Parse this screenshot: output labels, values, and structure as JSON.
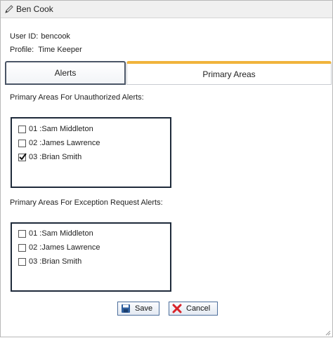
{
  "window": {
    "title": "Ben Cook"
  },
  "user": {
    "id_label": "User ID:",
    "id_value": "bencook",
    "profile_label": "Profile:",
    "profile_value": "Time Keeper"
  },
  "tabs": [
    {
      "label": "Alerts",
      "selected": true
    },
    {
      "label": "Primary Areas",
      "selected": false
    }
  ],
  "unauthorized": {
    "label": "Primary Areas For Unauthorized Alerts:",
    "items": [
      {
        "label": "01 :Sam Middleton",
        "checked": false
      },
      {
        "label": "02 :James Lawrence",
        "checked": false
      },
      {
        "label": "03 :Brian Smith",
        "checked": true
      }
    ]
  },
  "exception": {
    "label": "Primary Areas For Exception Request Alerts:",
    "items": [
      {
        "label": "01 :Sam Middleton",
        "checked": false
      },
      {
        "label": "02 :James Lawrence",
        "checked": false
      },
      {
        "label": "03 :Brian Smith",
        "checked": false
      }
    ]
  },
  "buttons": {
    "save": "Save",
    "cancel": "Cancel"
  },
  "colors": {
    "tab_accent": "#f0b43c",
    "border_dark": "#1e2a3a",
    "cancel_red": "#d8232a",
    "save_blue": "#2f5f9e"
  }
}
